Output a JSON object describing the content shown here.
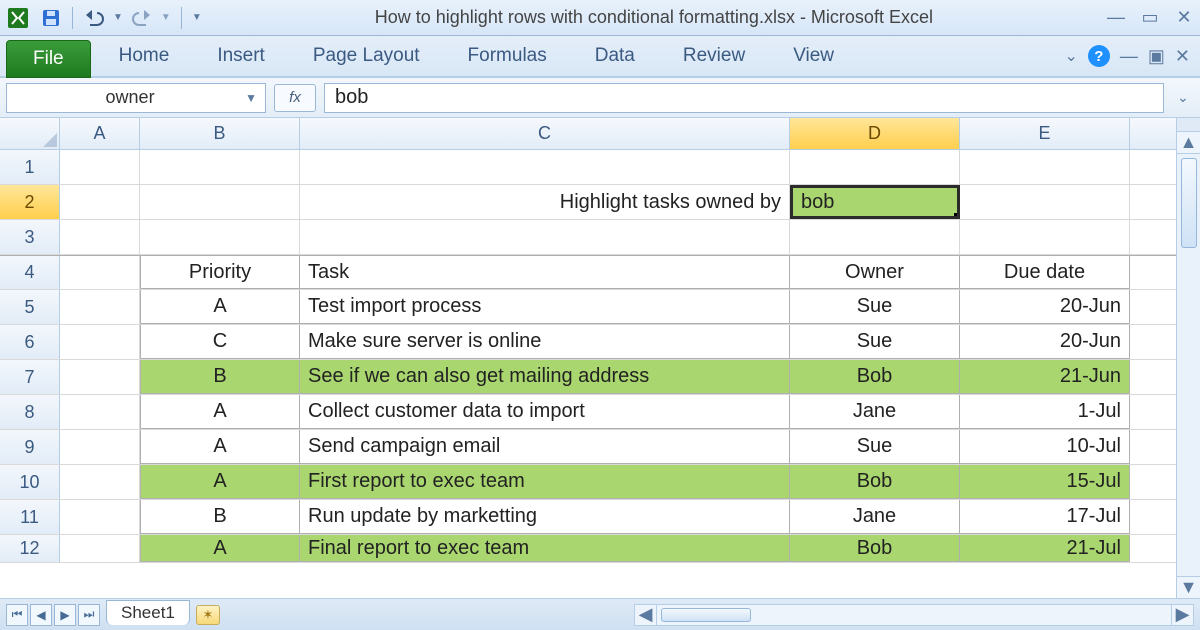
{
  "window": {
    "title": "How to highlight rows with conditional formatting.xlsx - Microsoft Excel"
  },
  "ribbon": {
    "file": "File",
    "tabs": [
      "Home",
      "Insert",
      "Page Layout",
      "Formulas",
      "Data",
      "Review",
      "View"
    ]
  },
  "formula_bar": {
    "name_box": "owner",
    "fx_label": "fx",
    "formula": "bob"
  },
  "columns": [
    "A",
    "B",
    "C",
    "D",
    "E"
  ],
  "row_numbers": [
    "1",
    "2",
    "3",
    "4",
    "5",
    "6",
    "7",
    "8",
    "9",
    "10",
    "11",
    "12"
  ],
  "active_column": "D",
  "active_row": "2",
  "row2": {
    "label": "Highlight tasks owned by",
    "value": "bob"
  },
  "table": {
    "headers": {
      "priority": "Priority",
      "task": "Task",
      "owner": "Owner",
      "due": "Due date"
    },
    "rows": [
      {
        "priority": "A",
        "task": "Test import process",
        "owner": "Sue",
        "due": "20-Jun",
        "hl": false
      },
      {
        "priority": "C",
        "task": "Make sure server is online",
        "owner": "Sue",
        "due": "20-Jun",
        "hl": false
      },
      {
        "priority": "B",
        "task": "See if we can also get mailing address",
        "owner": "Bob",
        "due": "21-Jun",
        "hl": true
      },
      {
        "priority": "A",
        "task": "Collect customer data to import",
        "owner": "Jane",
        "due": "1-Jul",
        "hl": false
      },
      {
        "priority": "A",
        "task": "Send campaign email",
        "owner": "Sue",
        "due": "10-Jul",
        "hl": false
      },
      {
        "priority": "A",
        "task": "First report to exec team",
        "owner": "Bob",
        "due": "15-Jul",
        "hl": true
      },
      {
        "priority": "B",
        "task": "Run update by marketting",
        "owner": "Jane",
        "due": "17-Jul",
        "hl": false
      },
      {
        "priority": "A",
        "task": "Final report to exec team",
        "owner": "Bob",
        "due": "21-Jul",
        "hl": true
      }
    ]
  },
  "sheet_tabs": {
    "active": "Sheet1"
  },
  "colors": {
    "highlight": "#a9d66f",
    "select_header": "#ffcf4d"
  }
}
